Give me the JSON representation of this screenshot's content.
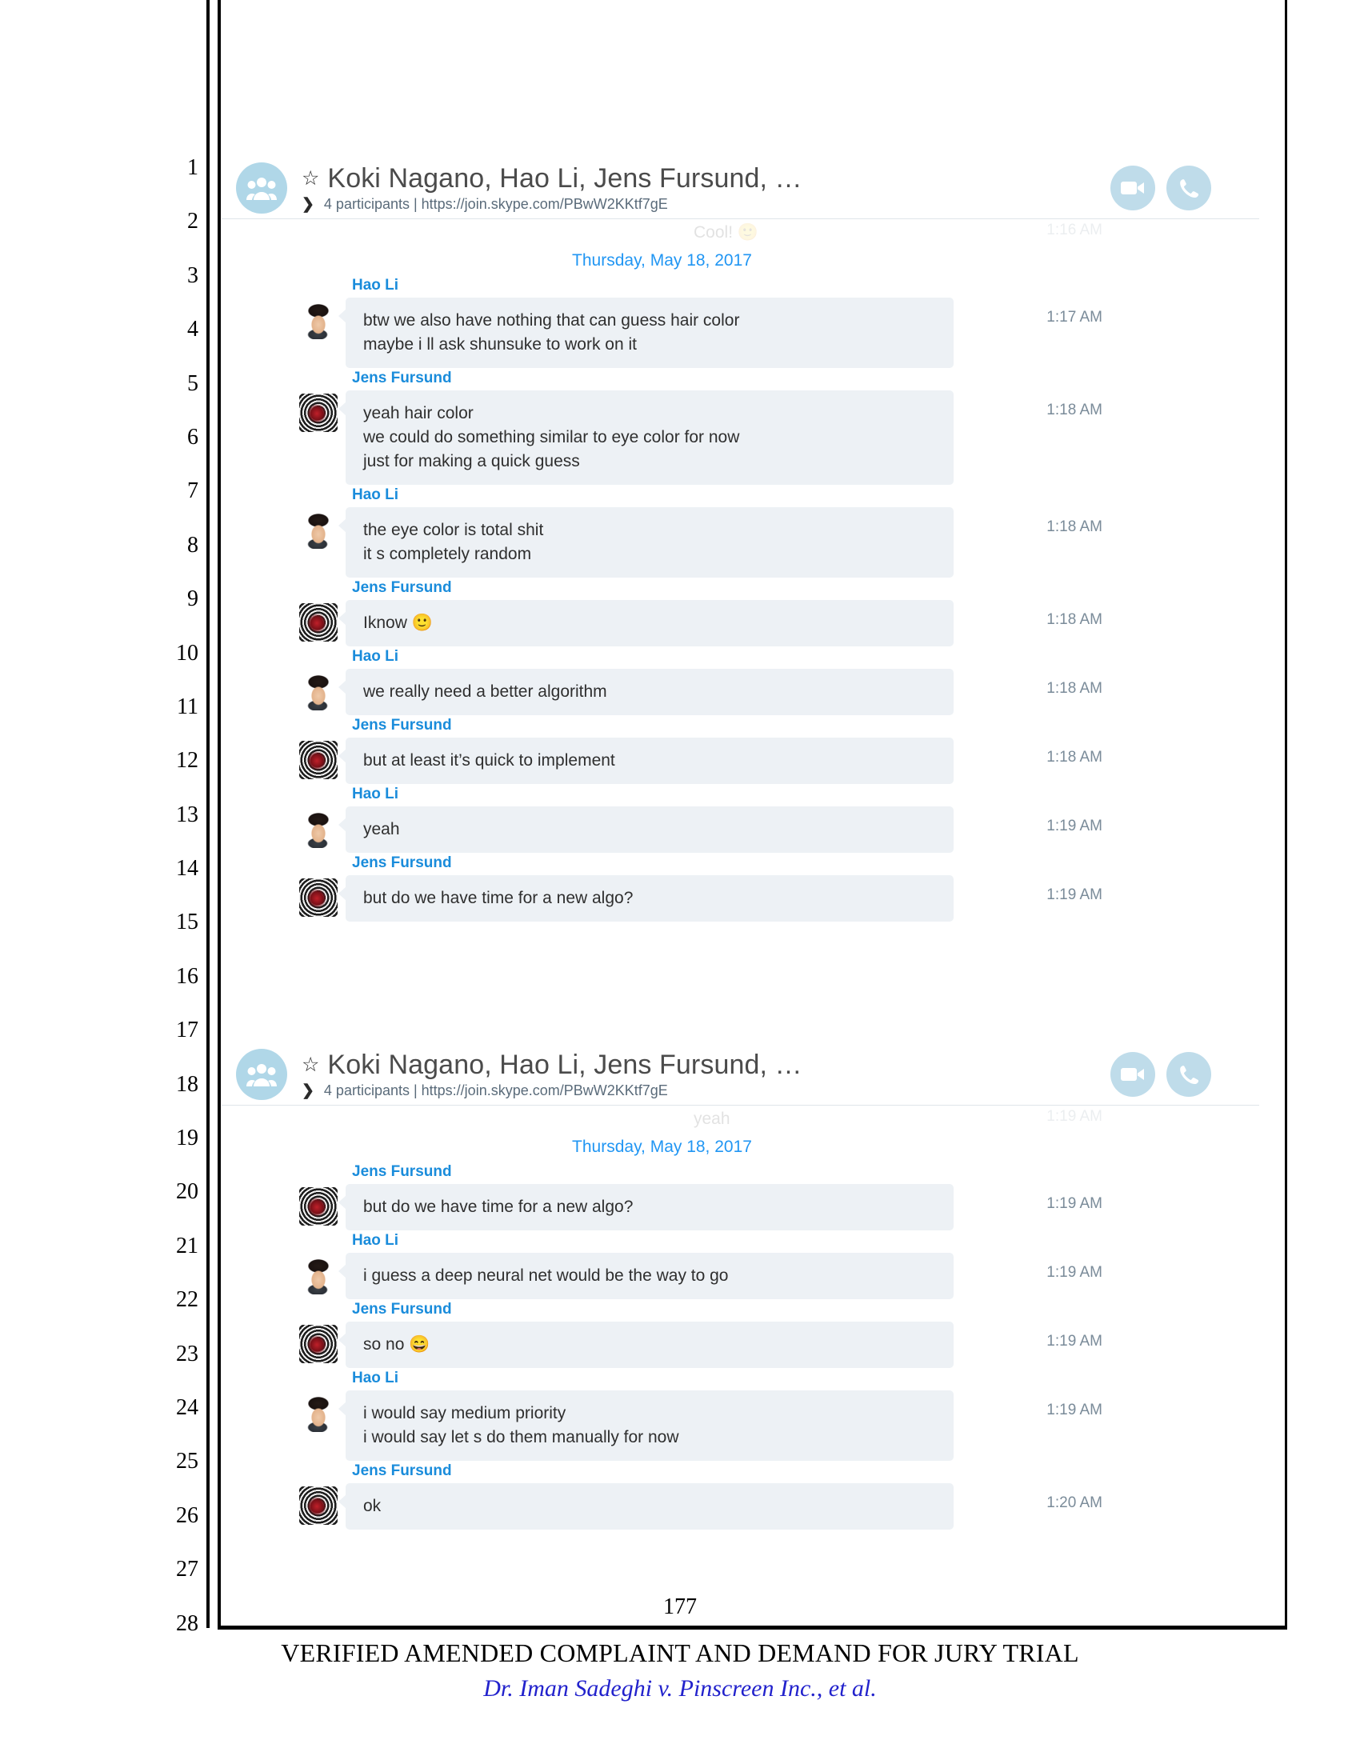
{
  "document": {
    "line_numbers": [
      "1",
      "2",
      "3",
      "4",
      "5",
      "6",
      "7",
      "8",
      "9",
      "10",
      "11",
      "12",
      "13",
      "14",
      "15",
      "16",
      "17",
      "18",
      "19",
      "20",
      "21",
      "22",
      "23",
      "24",
      "25",
      "26",
      "27",
      "28"
    ],
    "page_number": "177",
    "footer_title": "VERIFIED AMENDED COMPLAINT AND DEMAND FOR JURY TRIAL",
    "footer_case": "Dr. Iman Sadeghi v. Pinscreen Inc., et al."
  },
  "colors": {
    "accent_blue": "#1a8cdb",
    "date_blue": "#2196f3",
    "bubble_bg": "#edf1f5",
    "avatar_circle": "#b0d7e8",
    "action_circle": "#bfdcea",
    "timestamp": "#7a8b99",
    "case_blue": "#2222cc"
  },
  "screenshots": [
    {
      "header": {
        "star_icon": "star-icon",
        "title": "Koki Nagano, Hao Li, Jens Fursund, …",
        "chevron_icon": "chevron-right-icon",
        "subtitle": "4 participants  |  https://join.skype.com/PBwW2KKtf7gE",
        "group_icon": "group-people-icon",
        "video_icon": "video-call-icon",
        "phone_icon": "audio-call-icon"
      },
      "partial_message": {
        "text": "Cool! 🙂",
        "time": "1:16 AM"
      },
      "date_separator": "Thursday, May 18, 2017",
      "messages": [
        {
          "sender": "Hao Li",
          "avatar": "hao",
          "time": "1:17 AM",
          "lines": [
            "btw we also have nothing that can guess hair color",
            "maybe i ll ask shunsuke to work on it"
          ]
        },
        {
          "sender": "Jens Fursund",
          "avatar": "jens",
          "time": "1:18 AM",
          "lines": [
            "yeah hair color",
            "we could do something similar to eye color for now",
            "just for making a quick guess"
          ]
        },
        {
          "sender": "Hao Li",
          "avatar": "hao",
          "time": "1:18 AM",
          "lines": [
            "the eye color is total shit",
            "it s completely random"
          ]
        },
        {
          "sender": "Jens Fursund",
          "avatar": "jens",
          "time": "1:18 AM",
          "lines": [
            "Iknow 🙂"
          ]
        },
        {
          "sender": "Hao Li",
          "avatar": "hao",
          "time": "1:18 AM",
          "lines": [
            "we really need a better algorithm"
          ]
        },
        {
          "sender": "Jens Fursund",
          "avatar": "jens",
          "time": "1:18 AM",
          "lines": [
            "but at least it’s quick to implement"
          ]
        },
        {
          "sender": "Hao Li",
          "avatar": "hao",
          "time": "1:19 AM",
          "lines": [
            "yeah"
          ]
        },
        {
          "sender": "Jens Fursund",
          "avatar": "jens",
          "time": "1:19 AM",
          "lines": [
            "but do we have time for a new algo?"
          ]
        }
      ]
    },
    {
      "header": {
        "star_icon": "star-icon",
        "title": "Koki Nagano, Hao Li, Jens Fursund, …",
        "chevron_icon": "chevron-right-icon",
        "subtitle": "4 participants  |  https://join.skype.com/PBwW2KKtf7gE",
        "group_icon": "group-people-icon",
        "video_icon": "video-call-icon",
        "phone_icon": "audio-call-icon"
      },
      "partial_message": {
        "text": "yeah",
        "time": "1:19 AM"
      },
      "date_separator": "Thursday, May 18, 2017",
      "messages": [
        {
          "sender": "Jens Fursund",
          "avatar": "jens",
          "time": "1:19 AM",
          "lines": [
            "but do we have time for a new algo?"
          ]
        },
        {
          "sender": "Hao Li",
          "avatar": "hao",
          "time": "1:19 AM",
          "lines": [
            "i guess a deep neural net would be the way to go"
          ]
        },
        {
          "sender": "Jens Fursund",
          "avatar": "jens",
          "time": "1:19 AM",
          "lines": [
            "so no 😄"
          ]
        },
        {
          "sender": "Hao Li",
          "avatar": "hao",
          "time": "1:19 AM",
          "lines": [
            "i would say medium priority",
            "i would say let s do them manually for now"
          ]
        },
        {
          "sender": "Jens Fursund",
          "avatar": "jens",
          "time": "1:20 AM",
          "lines": [
            "ok"
          ]
        }
      ]
    }
  ]
}
